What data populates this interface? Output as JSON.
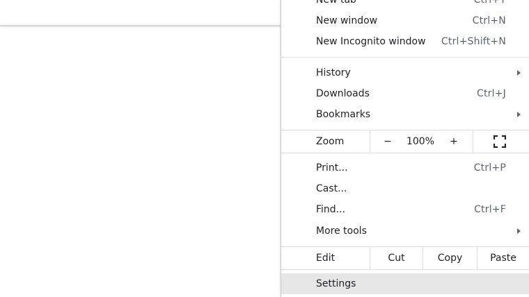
{
  "menu": {
    "top_items": [
      {
        "label": "New tab",
        "shortcut": "Ctrl+T"
      },
      {
        "label": "New window",
        "shortcut": "Ctrl+N"
      },
      {
        "label": "New Incognito window",
        "shortcut": "Ctrl+Shift+N"
      }
    ],
    "history": {
      "label": "History"
    },
    "downloads": {
      "label": "Downloads",
      "shortcut": "Ctrl+J"
    },
    "bookmarks": {
      "label": "Bookmarks"
    },
    "zoom": {
      "label": "Zoom",
      "minus": "−",
      "level": "100%",
      "plus": "+",
      "fullscreen_icon": "fullscreen-icon"
    },
    "print": {
      "label": "Print...",
      "shortcut": "Ctrl+P"
    },
    "cast": {
      "label": "Cast..."
    },
    "find": {
      "label": "Find...",
      "shortcut": "Ctrl+F"
    },
    "more_tools": {
      "label": "More tools"
    },
    "edit": {
      "label": "Edit",
      "cut": "Cut",
      "copy": "Copy",
      "paste": "Paste"
    },
    "settings": {
      "label": "Settings"
    }
  }
}
